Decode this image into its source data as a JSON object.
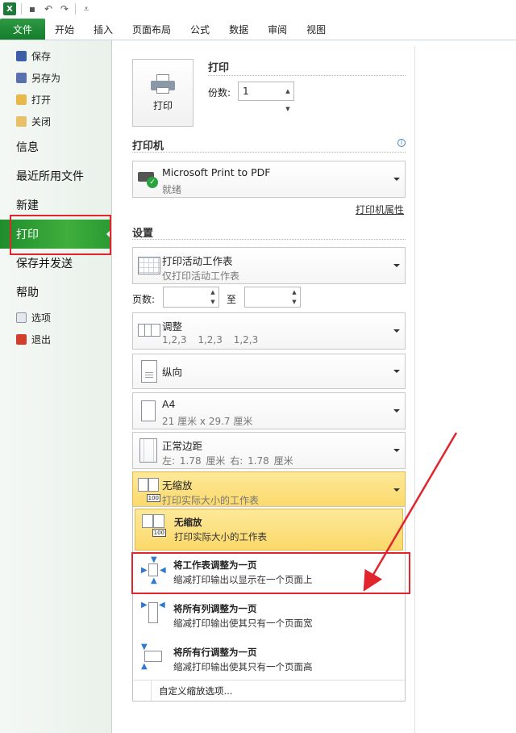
{
  "app": {
    "logo": "X"
  },
  "ribbon_tabs": [
    "文件",
    "开始",
    "插入",
    "页面布局",
    "公式",
    "数据",
    "审阅",
    "视图"
  ],
  "nav": {
    "small_top": [
      "保存",
      "另存为",
      "打开",
      "关闭"
    ],
    "big": [
      "信息",
      "最近所用文件",
      "新建",
      "打印",
      "保存并发送",
      "帮助"
    ],
    "small_bottom": [
      "选项",
      "退出"
    ],
    "active": "打印"
  },
  "print": {
    "button_label": "打印",
    "section_title": "打印",
    "copies_label": "份数:",
    "copies_value": "1"
  },
  "printer": {
    "section_title": "打印机",
    "name": "Microsoft Print to PDF",
    "status": "就绪",
    "properties_link": "打印机属性"
  },
  "settings": {
    "section_title": "设置",
    "what": {
      "title": "打印活动工作表",
      "desc": "仅打印活动工作表"
    },
    "pages_label": "页数:",
    "to_label": "至",
    "collate": {
      "title": "调整",
      "desc": "1,2,3 1,2,3 1,2,3"
    },
    "orientation": {
      "title": "纵向"
    },
    "paper": {
      "title": "A4",
      "desc": "21 厘米 x 29.7 厘米"
    },
    "margins": {
      "title": "正常边距",
      "desc": "左: 1.78 厘米 右: 1.78 厘米"
    },
    "scaling": {
      "title": "无缩放",
      "desc": "打印实际大小的工作表"
    }
  },
  "scaling_menu": {
    "items": [
      {
        "title": "无缩放",
        "desc": "打印实际大小的工作表"
      },
      {
        "title": "将工作表调整为一页",
        "desc": "缩减打印输出以显示在一个页面上"
      },
      {
        "title": "将所有列调整为一页",
        "desc": "缩减打印输出使其只有一个页面宽"
      },
      {
        "title": "将所有行调整为一页",
        "desc": "缩减打印输出使其只有一个页面高"
      }
    ],
    "custom": "自定义缩放选项..."
  },
  "badge_text": "100",
  "colors": {
    "file_tab": "#1f8d2c",
    "highlight": "#fbd869",
    "annotation": "#e0262c"
  }
}
